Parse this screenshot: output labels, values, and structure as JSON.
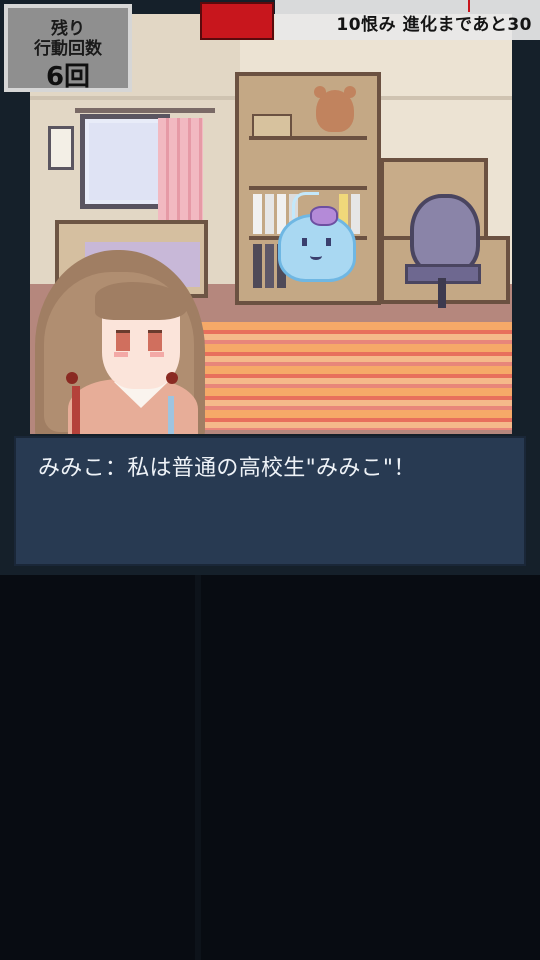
{
  "hud": {
    "counter_line1": "残り",
    "counter_line2": "行動回数",
    "counter_value": "6回",
    "status_text": "10恨み 進化まであと30",
    "meter_color": "#c8161d"
  },
  "dialogue": {
    "text": "みみこ：私は普通の高校生\"みみこ\"！"
  },
  "colors": {
    "dialogue_bg": "#283a52",
    "frame_bg": "#15202a"
  }
}
